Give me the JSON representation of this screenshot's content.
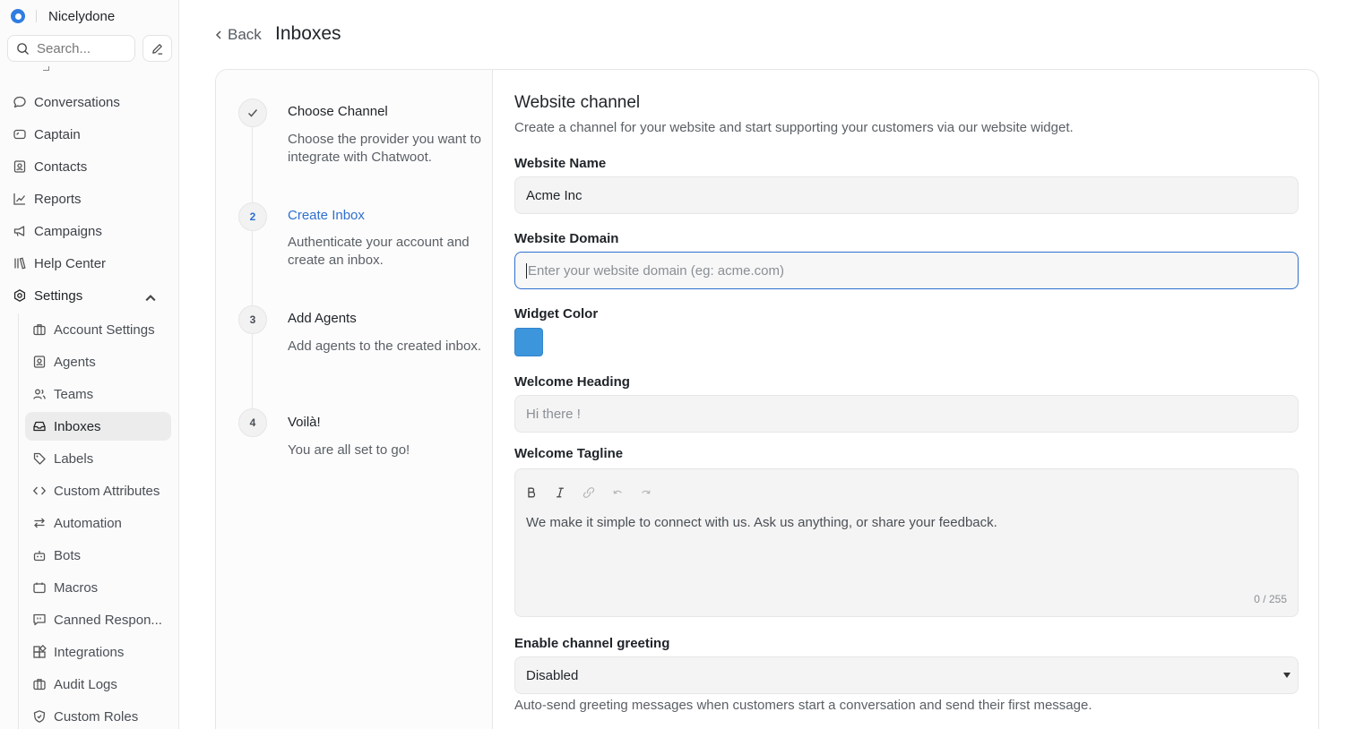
{
  "sidebar": {
    "account_name": "Nicelydone",
    "search_placeholder": "Search...",
    "nav": [
      {
        "label": "Conversations",
        "icon": "chat-bubble-icon"
      },
      {
        "label": "Captain",
        "icon": "captain-icon"
      },
      {
        "label": "Contacts",
        "icon": "contact-card-icon"
      },
      {
        "label": "Reports",
        "icon": "line-chart-icon"
      },
      {
        "label": "Campaigns",
        "icon": "megaphone-icon"
      },
      {
        "label": "Help Center",
        "icon": "library-icon"
      },
      {
        "label": "Settings",
        "icon": "gear-icon"
      }
    ],
    "settings_items": [
      {
        "label": "Account Settings",
        "icon": "briefcase-icon"
      },
      {
        "label": "Agents",
        "icon": "agent-icon"
      },
      {
        "label": "Teams",
        "icon": "team-icon"
      },
      {
        "label": "Inboxes",
        "icon": "inbox-icon"
      },
      {
        "label": "Labels",
        "icon": "tag-icon"
      },
      {
        "label": "Custom Attributes",
        "icon": "code-icon"
      },
      {
        "label": "Automation",
        "icon": "automation-icon"
      },
      {
        "label": "Bots",
        "icon": "bot-icon"
      },
      {
        "label": "Macros",
        "icon": "macro-icon"
      },
      {
        "label": "Canned Respon...",
        "icon": "canned-response-icon"
      },
      {
        "label": "Integrations",
        "icon": "integrations-icon"
      },
      {
        "label": "Audit Logs",
        "icon": "audit-log-icon"
      },
      {
        "label": "Custom Roles",
        "icon": "shield-icon"
      }
    ]
  },
  "header": {
    "back_label": "Back",
    "title": "Inboxes"
  },
  "steps": [
    {
      "marker": "",
      "title": "Choose Channel",
      "desc": "Choose the provider you want to integrate with Chatwoot.",
      "state": "done"
    },
    {
      "marker": "2",
      "title": "Create Inbox",
      "desc": "Authenticate your account and create an inbox.",
      "state": "current"
    },
    {
      "marker": "3",
      "title": "Add Agents",
      "desc": "Add agents to the created inbox.",
      "state": "pending"
    },
    {
      "marker": "4",
      "title": "Voilà!",
      "desc": "You are all set to go!",
      "state": "pending"
    }
  ],
  "form": {
    "title": "Website channel",
    "subtitle": "Create a channel for your website and start supporting your customers via our website widget.",
    "website_name_label": "Website Name",
    "website_name_value": "Acme Inc",
    "website_domain_label": "Website Domain",
    "website_domain_placeholder": "Enter your website domain (eg: acme.com)",
    "widget_color_label": "Widget Color",
    "widget_color": "#3d96dc",
    "welcome_heading_label": "Welcome Heading",
    "welcome_heading_placeholder": "Hi there !",
    "welcome_tagline_label": "Welcome Tagline",
    "welcome_tagline_text": "We make it simple to connect with us. Ask us anything, or share your feedback.",
    "tagline_counter": "0 / 255",
    "greeting_label": "Enable channel greeting",
    "greeting_value": "Disabled",
    "greeting_hint": "Auto-send greeting messages when customers start a conversation and send their first message."
  },
  "colors": {
    "accent": "#2f6fcf",
    "active_bg": "#ececec"
  }
}
